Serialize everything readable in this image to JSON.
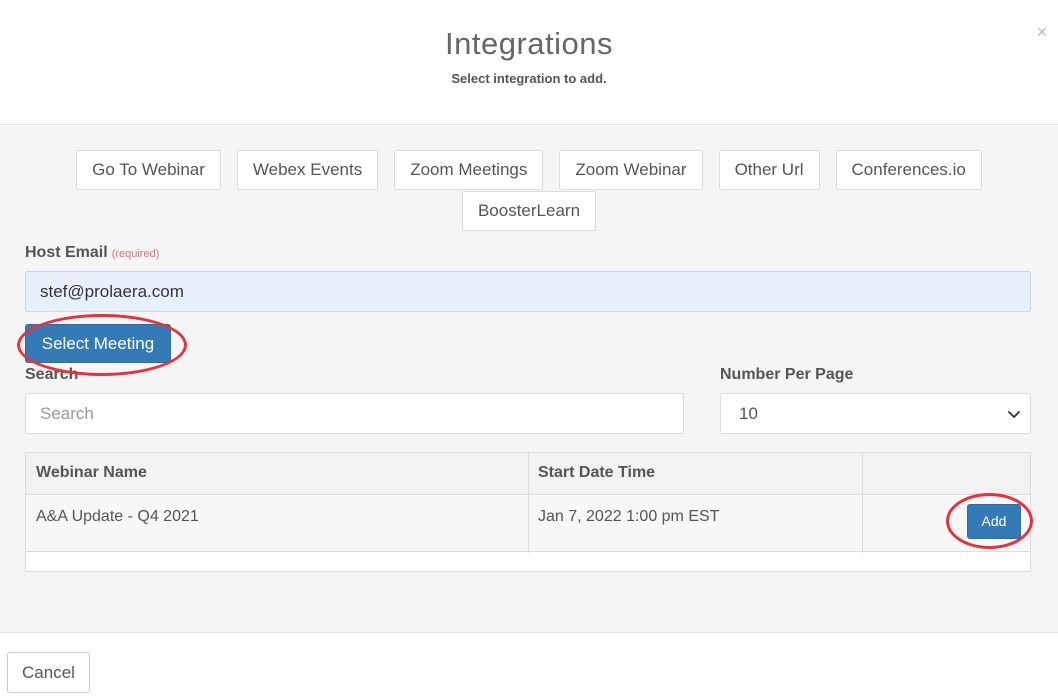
{
  "modal": {
    "title": "Integrations",
    "subtitle": "Select integration to add.",
    "close_label": "×"
  },
  "integrations": {
    "row1": [
      "Go To Webinar",
      "Webex Events",
      "Zoom Meetings",
      "Zoom Webinar",
      "Other Url",
      "Conferences.io"
    ],
    "row2": [
      "BoosterLearn"
    ]
  },
  "form": {
    "host_email_label": "Host Email",
    "required_text": "(required)",
    "host_email_value": "stef@prolaera.com",
    "select_meeting_label": "Select Meeting",
    "search_label": "Search",
    "search_placeholder": "Search",
    "per_page_label": "Number Per Page",
    "per_page_value": "10"
  },
  "table": {
    "columns": [
      "Webinar Name",
      "Start Date Time",
      ""
    ],
    "rows": [
      {
        "name": "A&A Update - Q4 2021",
        "start": "Jan 7, 2022 1:00 pm EST",
        "action": "Add"
      }
    ]
  },
  "footer": {
    "cancel_label": "Cancel"
  },
  "colors": {
    "primary": "#337ab7",
    "highlight_ring": "#e5323c",
    "email_fill": "#e8f0fe"
  }
}
